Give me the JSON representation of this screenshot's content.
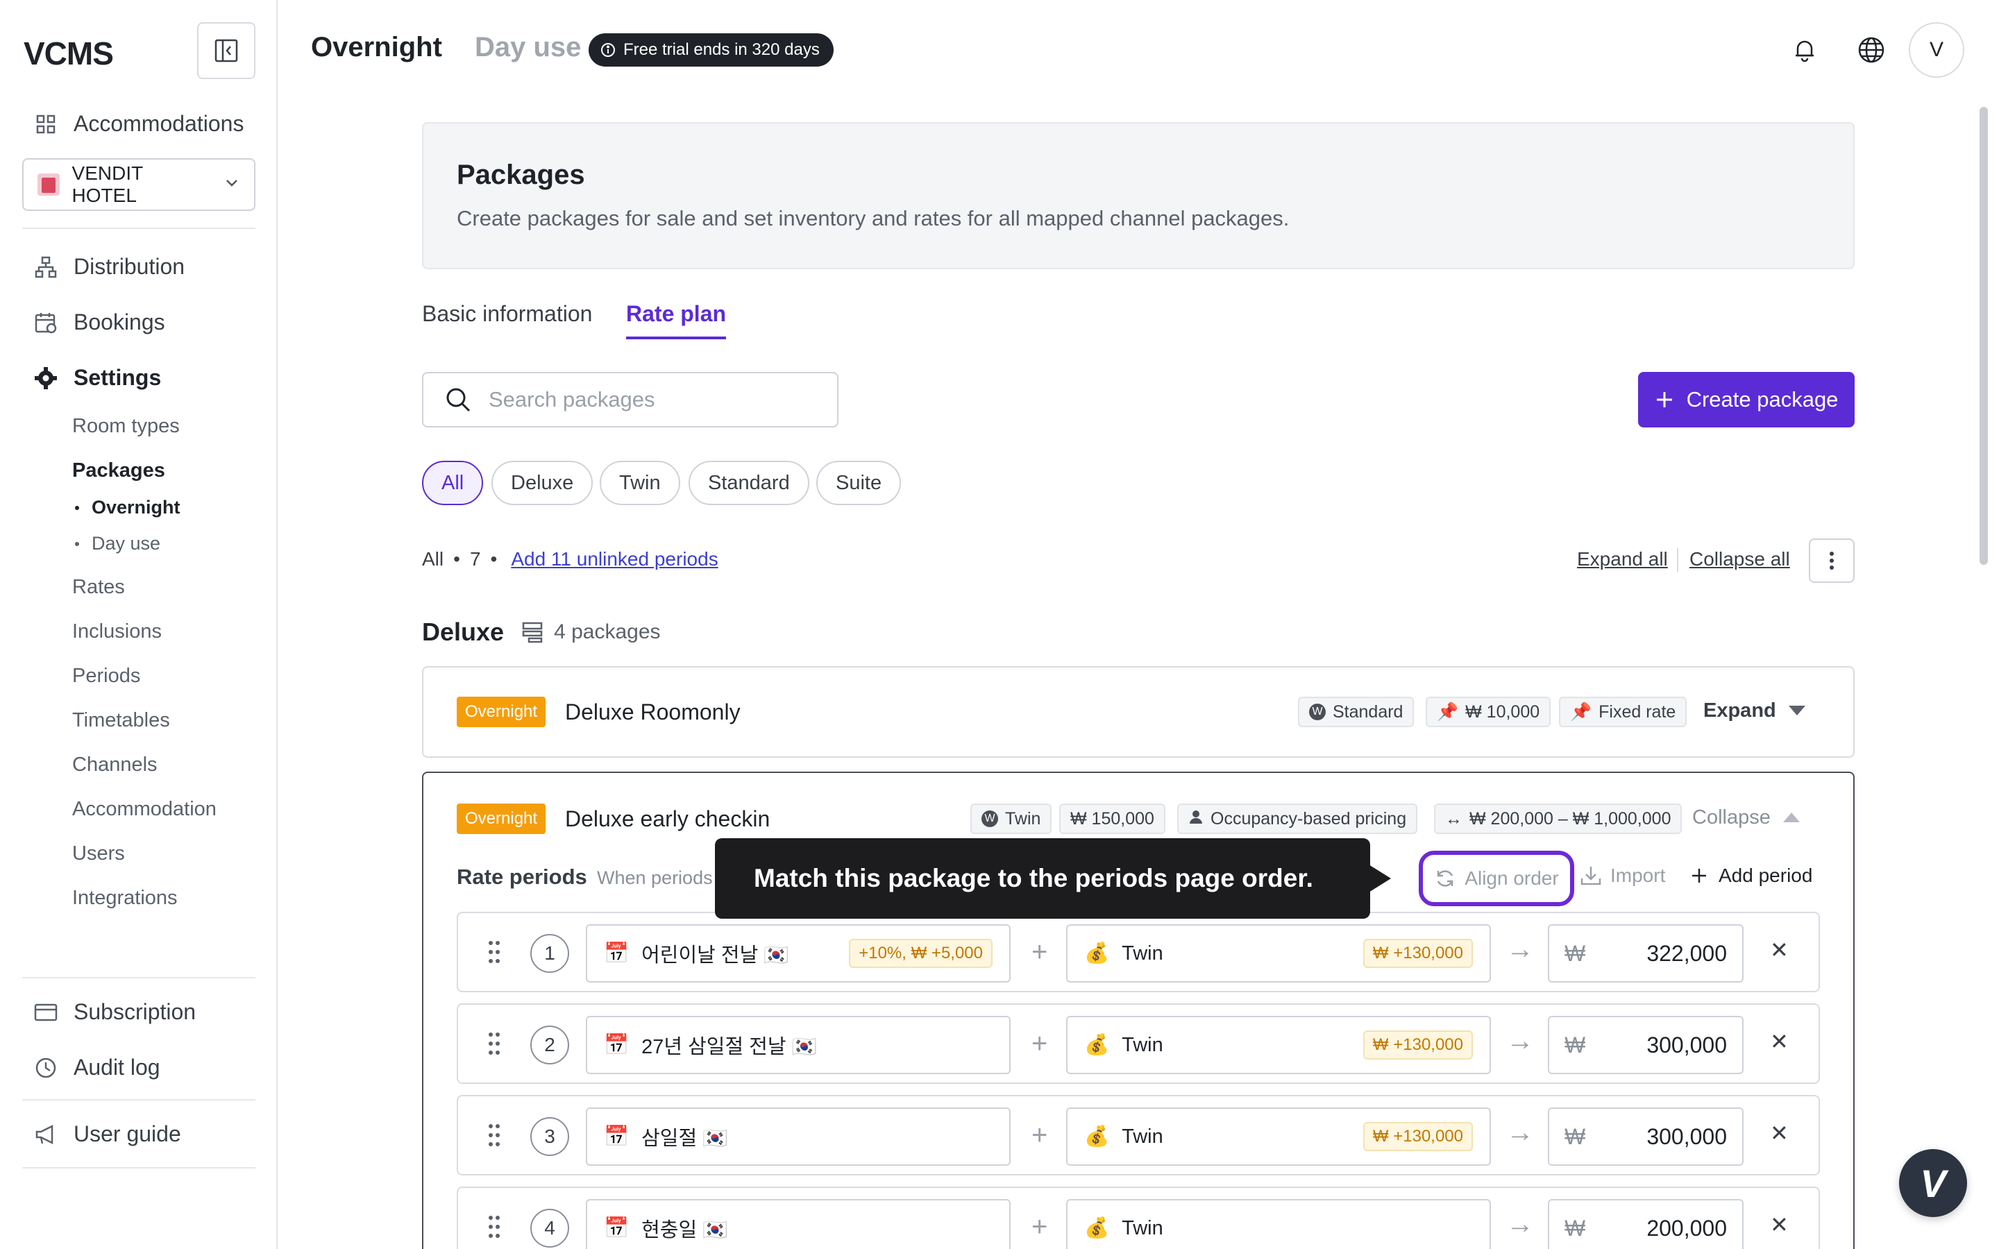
{
  "app": {
    "logo_text": "VCMS"
  },
  "sidebar": {
    "accommodations": "Accommodations",
    "hotel": "VENDIT HOTEL",
    "distribution": "Distribution",
    "bookings": "Bookings",
    "settings": "Settings",
    "settings_items": [
      "Room types",
      "Packages",
      "Rates",
      "Inclusions",
      "Periods",
      "Timetables",
      "Channels",
      "Accommodation",
      "Users",
      "Integrations"
    ],
    "packages_sub": [
      "Overnight",
      "Day use"
    ],
    "subscription": "Subscription",
    "audit_log": "Audit log",
    "user_guide": "User guide"
  },
  "topbar": {
    "tab_overnight": "Overnight",
    "tab_dayuse": "Day use",
    "trial": "Free trial ends in 320 days",
    "avatar": "V"
  },
  "header": {
    "title": "Packages",
    "description": "Create packages for sale and set inventory and rates for all mapped channel packages."
  },
  "subtabs": {
    "basic": "Basic information",
    "rate_plan": "Rate plan"
  },
  "search": {
    "placeholder": "Search packages"
  },
  "create_button": "Create package",
  "filters": [
    "All",
    "Deluxe",
    "Twin",
    "Standard",
    "Suite"
  ],
  "summary": {
    "all": "All",
    "count": "7",
    "unlinked": "Add 11 unlinked periods",
    "expand_all": "Expand all",
    "collapse_all": "Collapse all"
  },
  "group": {
    "name": "Deluxe",
    "count": "4 packages"
  },
  "packages": [
    {
      "badge": "Overnight",
      "name": "Deluxe Roomonly",
      "tags": [
        "Standard",
        "₩ 10,000",
        "Fixed rate"
      ],
      "action": "Expand"
    },
    {
      "badge": "Overnight",
      "name": "Deluxe early checkin",
      "tags": [
        "Twin",
        "₩ 150,000",
        "Occupancy-based pricing",
        "₩ 200,000 – ₩ 1,000,000"
      ],
      "action": "Collapse"
    }
  ],
  "rate_periods": {
    "label": "Rate periods",
    "sub": "When periods",
    "tooltip": "Match this package to the periods page order.",
    "align": "Align order",
    "import": "Import",
    "add": "Add period",
    "rows": [
      {
        "num": "1",
        "period": "어린이날 전날 🇰🇷",
        "modifier": "+10%, ₩ +5,000",
        "room": "Twin",
        "room_mod": "₩ +130,000",
        "currency": "₩",
        "price": "322,000"
      },
      {
        "num": "2",
        "period": "27년 삼일절 전날 🇰🇷",
        "modifier": "",
        "room": "Twin",
        "room_mod": "₩ +130,000",
        "currency": "₩",
        "price": "300,000"
      },
      {
        "num": "3",
        "period": "삼일절 🇰🇷",
        "modifier": "",
        "room": "Twin",
        "room_mod": "₩ +130,000",
        "currency": "₩",
        "price": "300,000"
      },
      {
        "num": "4",
        "period": "현충일 🇰🇷",
        "modifier": "",
        "room": "Twin",
        "room_mod": "",
        "currency": "₩",
        "price": "200,000"
      }
    ]
  },
  "fab": "V",
  "colors": {
    "accent": "#5b2bd6",
    "overnight": "#f59e0b",
    "highlight": "#6d28d9"
  }
}
